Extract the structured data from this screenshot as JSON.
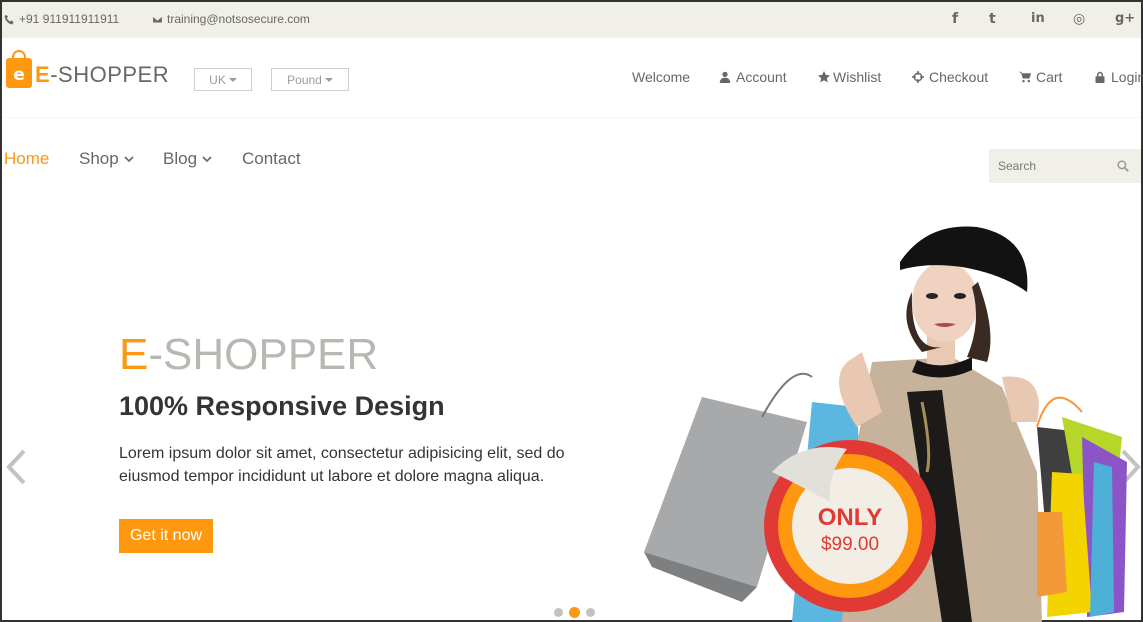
{
  "topbar": {
    "phone": "+91 911911911911",
    "email": "training@notsosecure.com",
    "social": [
      "facebook-icon",
      "twitter-icon",
      "linkedin-icon",
      "dribbble-icon",
      "google-plus-icon"
    ],
    "social_glyphs": [
      "f",
      "t",
      "in",
      "◎",
      "g+"
    ]
  },
  "logo": {
    "letter": "e",
    "prefix": "E",
    "rest": "-SHOPPER"
  },
  "selectors": {
    "country": "UK",
    "currency": "Pound"
  },
  "usernav": {
    "welcome": "Welcome",
    "account": "Account",
    "wishlist": "Wishlist",
    "checkout": "Checkout",
    "cart": "Cart",
    "login": "Login"
  },
  "mainnav": {
    "home": "Home",
    "shop": "Shop",
    "blog": "Blog",
    "contact": "Contact"
  },
  "search": {
    "placeholder": "Search"
  },
  "slider": {
    "title_prefix": "E",
    "title_rest": "-SHOPPER",
    "subtitle": "100% Responsive Design",
    "text": "Lorem ipsum dolor sit amet, consectetur adipisicing elit, sed do eiusmod tempor incididunt ut labore et dolore magna aliqua.",
    "button": "Get it now",
    "badge_top": "ONLY",
    "badge_price": "$99.00",
    "active_slide": 2,
    "slide_count": 3
  },
  "colors": {
    "accent": "#FE980F",
    "topbar": "#f0f0e9",
    "text": "#696763",
    "badge": "#e13a35"
  }
}
